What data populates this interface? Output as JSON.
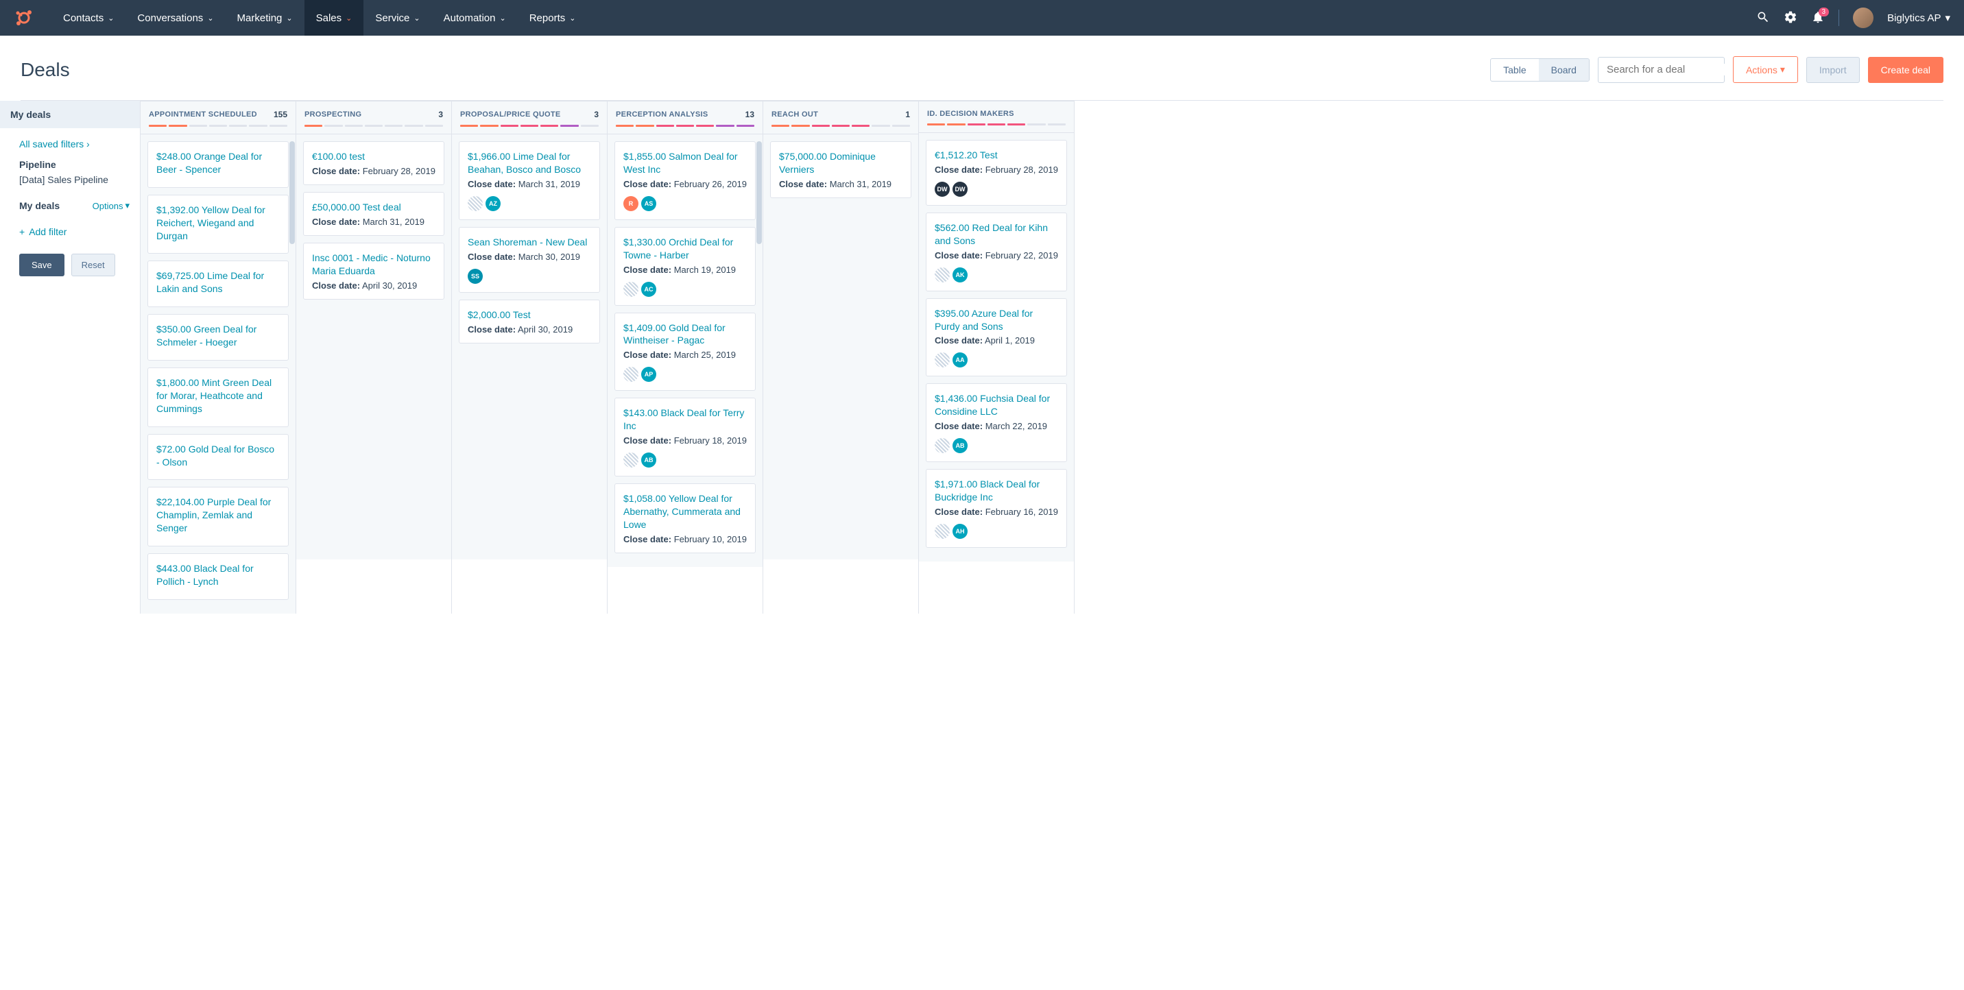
{
  "nav": {
    "items": [
      "Contacts",
      "Conversations",
      "Marketing",
      "Sales",
      "Service",
      "Automation",
      "Reports"
    ],
    "activeIndex": 3,
    "notificationCount": "3",
    "userName": "Biglytics AP"
  },
  "header": {
    "title": "Deals",
    "viewTable": "Table",
    "viewBoard": "Board",
    "searchPlaceholder": "Search for a deal",
    "actions": "Actions",
    "import": "Import",
    "createDeal": "Create deal"
  },
  "sidebar": {
    "tab": "My deals",
    "savedFilters": "All saved filters",
    "pipelineLabel": "Pipeline",
    "pipelineValue": "[Data] Sales Pipeline",
    "myDealsLabel": "My deals",
    "options": "Options",
    "addFilter": "Add filter",
    "save": "Save",
    "reset": "Reset"
  },
  "closeLabel": "Close date:",
  "progColors": {
    "orange": "#ff7a59",
    "pink": "#f2547d",
    "purple": "#b15dc4",
    "grey": "#dfe3eb"
  },
  "columns": [
    {
      "title": "APPOINTMENT SCHEDULED",
      "count": "155",
      "prog": [
        "orange",
        "orange",
        "grey",
        "grey",
        "grey",
        "grey",
        "grey"
      ],
      "scrollbar": true,
      "cards": [
        {
          "title": "$248.00 Orange Deal for Beer - Spencer"
        },
        {
          "title": "$1,392.00 Yellow Deal for Reichert, Wiegand and Durgan"
        },
        {
          "title": "$69,725.00 Lime Deal for Lakin and Sons"
        },
        {
          "title": "$350.00 Green Deal for Schmeler - Hoeger"
        },
        {
          "title": "$1,800.00 Mint Green Deal for Morar, Heathcote and Cummings"
        },
        {
          "title": "$72.00 Gold Deal for Bosco - Olson"
        },
        {
          "title": "$22,104.00 Purple Deal for Champlin, Zemlak and Senger"
        },
        {
          "title": "$443.00 Black Deal for Pollich - Lynch"
        }
      ]
    },
    {
      "title": "PROSPECTING",
      "count": "3",
      "prog": [
        "orange",
        "grey",
        "grey",
        "grey",
        "grey",
        "grey",
        "grey"
      ],
      "cards": [
        {
          "title": "€100.00 test",
          "close": "February 28, 2019"
        },
        {
          "title": "£50,000.00 Test deal",
          "close": "March 31, 2019"
        },
        {
          "title": "Insc 0001 - Medic - Noturno Maria Eduarda",
          "close": "April 30, 2019"
        }
      ]
    },
    {
      "title": "PROPOSAL/PRICE QUOTE",
      "count": "3",
      "prog": [
        "orange",
        "orange",
        "pink",
        "pink",
        "pink",
        "purple",
        "grey"
      ],
      "cards": [
        {
          "title": "$1,966.00 Lime Deal for Beahan, Bosco and Bosco",
          "close": "March 31, 2019",
          "avatars": [
            {
              "cls": "hatched",
              "txt": ""
            },
            {
              "cls": "teal",
              "txt": "AZ"
            }
          ]
        },
        {
          "title": "Sean Shoreman - New Deal",
          "close": "March 30, 2019",
          "avatars": [
            {
              "cls": "blue",
              "txt": "SS"
            }
          ]
        },
        {
          "title": "$2,000.00 Test",
          "close": "April 30, 2019"
        }
      ]
    },
    {
      "title": "PERCEPTION ANALYSIS",
      "count": "13",
      "prog": [
        "orange",
        "orange",
        "pink",
        "pink",
        "pink",
        "purple",
        "purple"
      ],
      "scrollbar": true,
      "cards": [
        {
          "title": "$1,855.00 Salmon Deal for West Inc",
          "close": "February 26, 2019",
          "avatars": [
            {
              "cls": "orange",
              "txt": "R"
            },
            {
              "cls": "teal",
              "txt": "AS"
            }
          ]
        },
        {
          "title": "$1,330.00 Orchid Deal for Towne - Harber",
          "close": "March 19, 2019",
          "avatars": [
            {
              "cls": "hatched",
              "txt": ""
            },
            {
              "cls": "teal",
              "txt": "AC"
            }
          ]
        },
        {
          "title": "$1,409.00 Gold Deal for Wintheiser - Pagac",
          "close": "March 25, 2019",
          "avatars": [
            {
              "cls": "hatched",
              "txt": ""
            },
            {
              "cls": "teal",
              "txt": "AP"
            }
          ]
        },
        {
          "title": "$143.00 Black Deal for Terry Inc",
          "close": "February 18, 2019",
          "avatars": [
            {
              "cls": "hatched",
              "txt": ""
            },
            {
              "cls": "teal",
              "txt": "AB"
            }
          ]
        },
        {
          "title": "$1,058.00 Yellow Deal for Abernathy, Cummerata and Lowe",
          "close": "February 10, 2019"
        }
      ]
    },
    {
      "title": "REACH OUT",
      "count": "1",
      "prog": [
        "orange",
        "orange",
        "pink",
        "pink",
        "pink",
        "grey",
        "grey"
      ],
      "cards": [
        {
          "title": "$75,000.00 Dominique Verniers",
          "close": "March 31, 2019"
        }
      ]
    },
    {
      "title": "ID. DECISION MAKERS",
      "count": "",
      "prog": [
        "orange",
        "orange",
        "pink",
        "pink",
        "pink",
        "grey",
        "grey"
      ],
      "cards": [
        {
          "title": "€1,512.20 Test",
          "close": "February 28, 2019",
          "avatars": [
            {
              "cls": "dark",
              "txt": "DW"
            },
            {
              "cls": "dark",
              "txt": "DW"
            }
          ]
        },
        {
          "title": "$562.00 Red Deal for Kihn and Sons",
          "close": "February 22, 2019",
          "avatars": [
            {
              "cls": "hatched",
              "txt": ""
            },
            {
              "cls": "teal",
              "txt": "AK"
            }
          ]
        },
        {
          "title": "$395.00 Azure Deal for Purdy and Sons",
          "close": "April 1, 2019",
          "avatars": [
            {
              "cls": "hatched",
              "txt": ""
            },
            {
              "cls": "teal",
              "txt": "AA"
            }
          ]
        },
        {
          "title": "$1,436.00 Fuchsia Deal for Considine LLC",
          "close": "March 22, 2019",
          "avatars": [
            {
              "cls": "hatched",
              "txt": ""
            },
            {
              "cls": "teal",
              "txt": "AB"
            }
          ]
        },
        {
          "title": "$1,971.00 Black Deal for Buckridge Inc",
          "close": "February 16, 2019",
          "avatars": [
            {
              "cls": "hatched",
              "txt": ""
            },
            {
              "cls": "teal",
              "txt": "AH"
            }
          ]
        }
      ]
    }
  ]
}
